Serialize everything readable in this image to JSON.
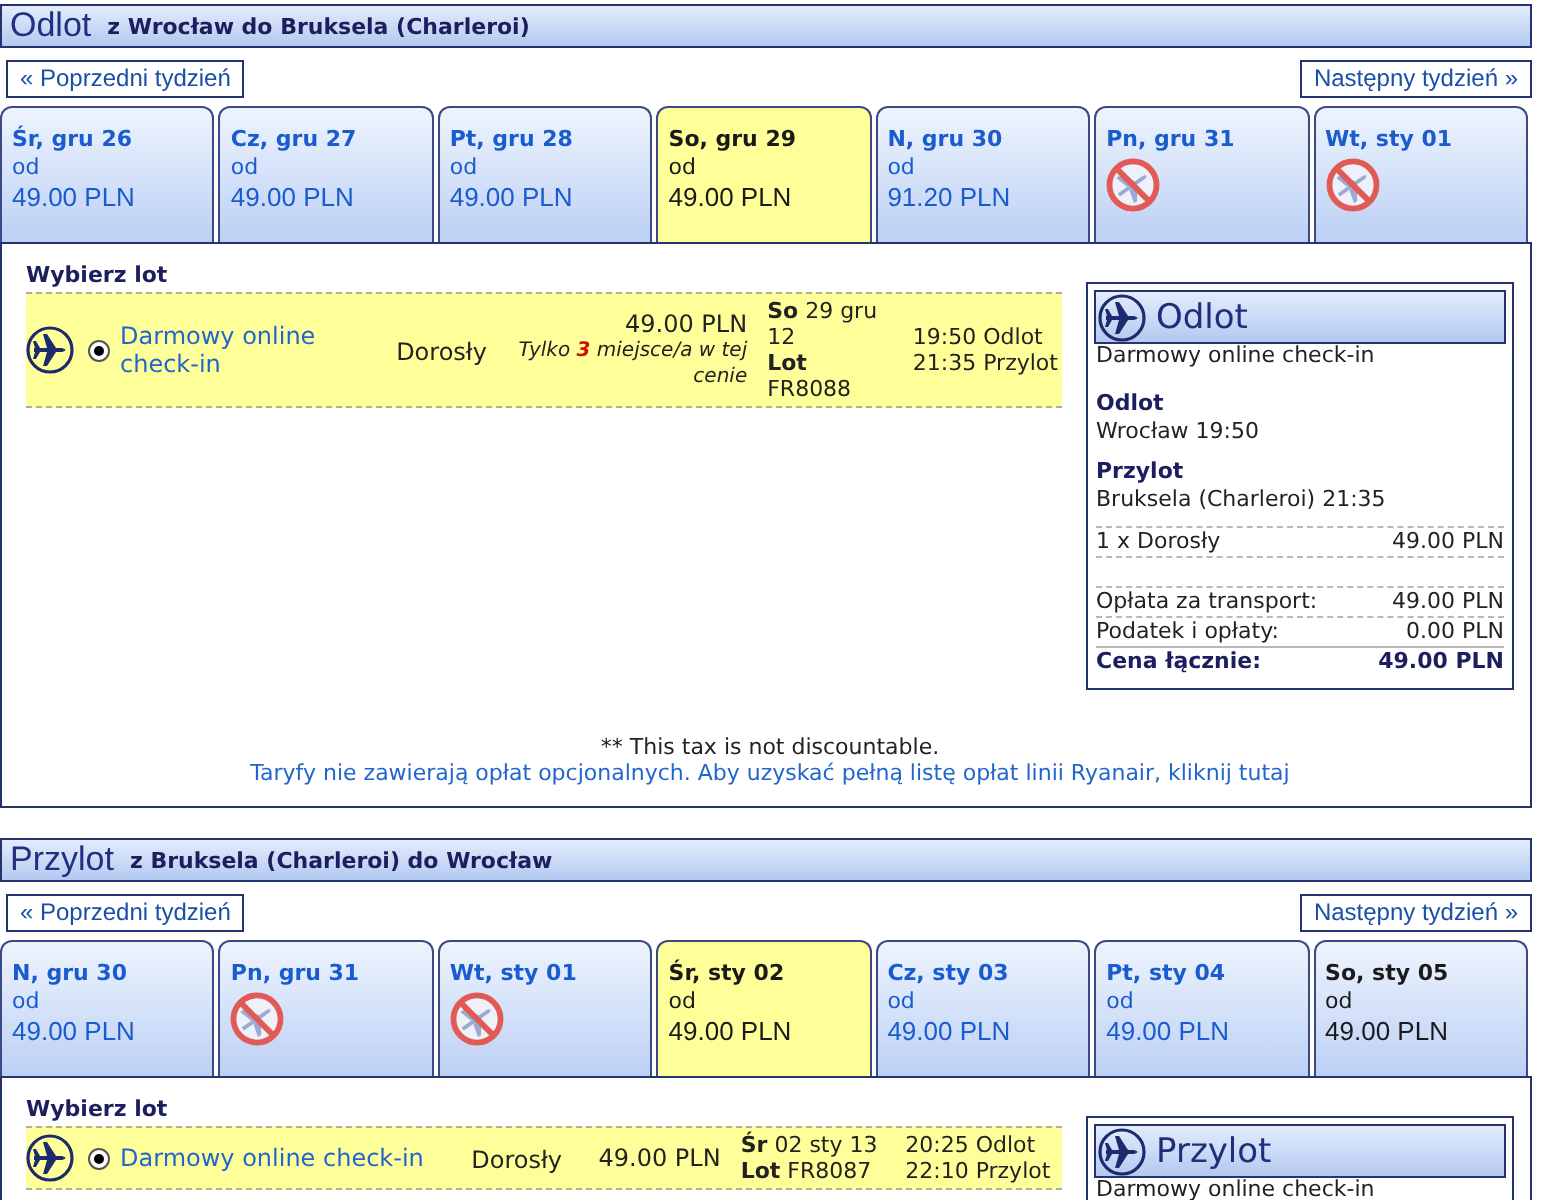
{
  "sections": [
    {
      "title": "Odlot",
      "route": "z Wrocław do Bruksela (Charleroi)",
      "prev_week": "« Poprzedni tydzień",
      "next_week": "Następny tydzień »",
      "days": [
        {
          "kind": "fare",
          "label": "Śr, gru 26",
          "from": "od",
          "price": "49.00 PLN",
          "selected": false,
          "linked": true
        },
        {
          "kind": "fare",
          "label": "Cz, gru 27",
          "from": "od",
          "price": "49.00 PLN",
          "selected": false,
          "linked": true
        },
        {
          "kind": "fare",
          "label": "Pt, gru 28",
          "from": "od",
          "price": "49.00 PLN",
          "selected": false,
          "linked": true
        },
        {
          "kind": "fare",
          "label": "So, gru 29",
          "from": "od",
          "price": "49.00 PLN",
          "selected": true,
          "linked": false
        },
        {
          "kind": "fare",
          "label": "N, gru 30",
          "from": "od",
          "price": "91.20 PLN",
          "selected": false,
          "linked": true
        },
        {
          "kind": "no_flights",
          "label": "Pn, gru 31",
          "selected": false,
          "linked": true
        },
        {
          "kind": "no_flights",
          "label": "Wt, sty 01",
          "selected": false,
          "linked": true
        }
      ],
      "choose_label": "Wybierz lot",
      "flights": [
        {
          "fare": "Darmowy online check-in",
          "selected": true,
          "passenger": "Dorosły",
          "price": "49.00 PLN",
          "note": "Tylko **3** miejsce/a w tej cenie",
          "date": "**So** 29 gru 12",
          "flight_no": "**Lot** FR8088",
          "departure": "19:50 Odlot",
          "arrival": "21:35 Przylot"
        }
      ],
      "summary": {
        "title": "Odlot",
        "fare": "Darmowy online check-in",
        "details": [
          {
            "label": "Odlot",
            "value": "Wrocław 19:50"
          },
          {
            "label": "Przylot",
            "value": "Bruksela (Charleroi) 21:35"
          }
        ],
        "passengers": [
          {
            "label": "1 x Dorosły",
            "amount": "49.00 PLN"
          }
        ],
        "fees": [
          {
            "label": "Opłata za transport:",
            "amount": "49.00 PLN"
          },
          {
            "label": "Podatek i opłaty:",
            "amount": "0.00 PLN"
          }
        ],
        "total": {
          "label": "Cena łącznie:",
          "amount": "49.00 PLN"
        }
      },
      "notes": {
        "tax": "** This tax is not discountable.",
        "fees_link": "Taryfy nie zawierają opłat opcjonalnych. Aby uzyskać pełną listę opłat linii Ryanair, kliknij tutaj"
      }
    },
    {
      "title": "Przylot",
      "route": "z Bruksela (Charleroi) do Wrocław",
      "prev_week": "« Poprzedni tydzień",
      "next_week": "Następny tydzień »",
      "days": [
        {
          "kind": "fare",
          "label": "N, gru 30",
          "from": "od",
          "price": "49.00 PLN",
          "selected": false,
          "linked": true
        },
        {
          "kind": "no_flights",
          "label": "Pn, gru 31",
          "selected": false,
          "linked": true
        },
        {
          "kind": "no_flights",
          "label": "Wt, sty 01",
          "selected": false,
          "linked": true
        },
        {
          "kind": "fare",
          "label": "Śr, sty 02",
          "from": "od",
          "price": "49.00 PLN",
          "selected": true,
          "linked": false
        },
        {
          "kind": "fare",
          "label": "Cz, sty 03",
          "from": "od",
          "price": "49.00 PLN",
          "selected": false,
          "linked": true
        },
        {
          "kind": "fare",
          "label": "Pt, sty 04",
          "from": "od",
          "price": "49.00 PLN",
          "selected": false,
          "linked": true
        },
        {
          "kind": "fare",
          "label": "So, sty 05",
          "from": "od",
          "price": "49.00 PLN",
          "selected": false,
          "linked": false
        }
      ],
      "choose_label": "Wybierz lot",
      "flights": [
        {
          "fare": "Darmowy online check-in",
          "selected": true,
          "passenger": "Dorosły",
          "price": "49.00 PLN",
          "date": "**Śr** 02 sty 13",
          "flight_no": "**Lot** FR8087",
          "departure": "20:25 Odlot",
          "arrival": "22:10 Przylot"
        }
      ],
      "summary": {
        "title": "Przylot",
        "fare": "Darmowy online check-in"
      }
    }
  ]
}
